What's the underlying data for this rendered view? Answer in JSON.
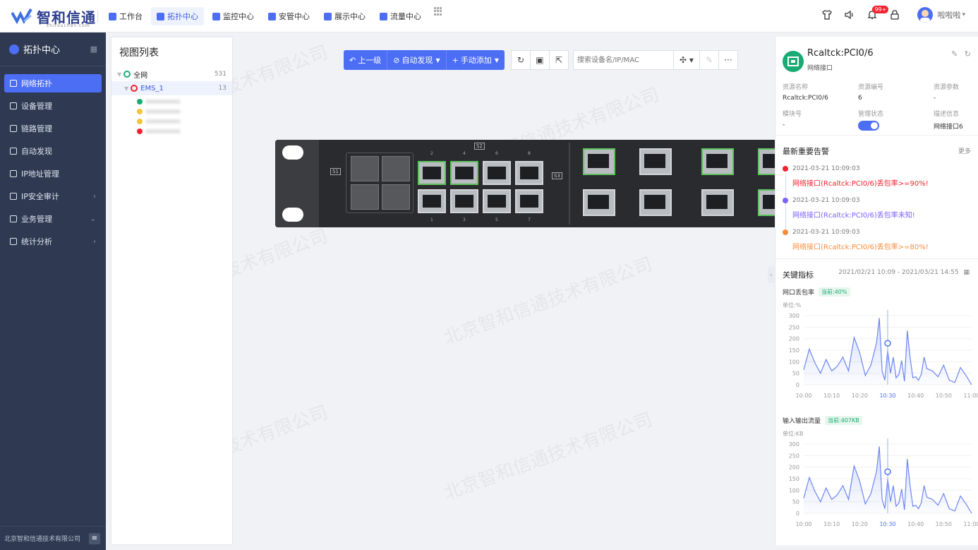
{
  "header": {
    "logo_text": "智和信通",
    "logo_sub": "zhitouchan.com",
    "nav": [
      {
        "label": "工作台",
        "icon": "home-icon",
        "color": "#4c6ef5",
        "active": false
      },
      {
        "label": "拓扑中心",
        "icon": "topology-icon",
        "color": "#4c6ef5",
        "active": true
      },
      {
        "label": "监控中心",
        "icon": "monitor-icon",
        "color": "#4c6ef5",
        "active": false
      },
      {
        "label": "安管中心",
        "icon": "shield-icon",
        "color": "#4c6ef5",
        "active": false
      },
      {
        "label": "展示中心",
        "icon": "display-icon",
        "color": "#4c6ef5",
        "active": false
      },
      {
        "label": "流量中心",
        "icon": "traffic-icon",
        "color": "#4c6ef5",
        "active": false
      }
    ],
    "notify_badge": "99+",
    "user_name": "啦啦啦"
  },
  "sidebar": {
    "title": "拓扑中心",
    "items": [
      {
        "label": "网络拓扑",
        "active": true,
        "arrow": ""
      },
      {
        "label": "设备管理",
        "active": false,
        "arrow": ""
      },
      {
        "label": "链路管理",
        "active": false,
        "arrow": ""
      },
      {
        "label": "自动发现",
        "active": false,
        "arrow": ""
      },
      {
        "label": "IP地址管理",
        "active": false,
        "arrow": ""
      },
      {
        "label": "IP安全审计",
        "active": false,
        "arrow": ">"
      },
      {
        "label": "业务管理",
        "active": false,
        "arrow": "v"
      },
      {
        "label": "统计分析",
        "active": false,
        "arrow": ">"
      }
    ],
    "footer": "北京智和信通技术有限公司"
  },
  "view_panel": {
    "title": "视图列表",
    "tree": [
      {
        "label": "全网",
        "count": "531",
        "color": "#1aaa73",
        "selected": false
      },
      {
        "label": "EMS_1",
        "count": "13",
        "color": "#f5222d",
        "selected": true
      }
    ]
  },
  "toolbar": {
    "up_level": "上一级",
    "auto_discover": "自动发现",
    "manual_add": "手动添加",
    "search_placeholder": "搜索设备名/IP/MAC"
  },
  "watermark": "北京智和信通技术有限公司",
  "device": {
    "slot_labels": [
      "S1",
      "S2",
      "S3"
    ],
    "top_port_numbers": [
      "2",
      "4",
      "6",
      "8"
    ],
    "bottom_port_numbers": [
      "1",
      "3",
      "5",
      "7"
    ]
  },
  "detail": {
    "name": "Rcaltck:PCI0/6",
    "type": "网络接口",
    "fields": [
      {
        "key": "资源名称",
        "value": "Rcaltck:PCI0/6"
      },
      {
        "key": "资源编号",
        "value": "6"
      },
      {
        "key": "资源参数",
        "value": "-"
      },
      {
        "key": "模块号",
        "value": "-"
      },
      {
        "key": "管理状态",
        "value": ""
      },
      {
        "key": "描述信息",
        "value": "网络接口6"
      }
    ]
  },
  "alarms": {
    "title": "最新重要告警",
    "more": "更多",
    "items": [
      {
        "time": "2021-03-21 10:09:03",
        "message": "网络接口(Rcaltck:PCI0/6)丢包率>=90%!",
        "color": "#f5222d"
      },
      {
        "time": "2021-03-21 10:09:03",
        "message": "网络接口(Rcaltck:PCI0/6)丢包率未知!",
        "color": "#7b61ff"
      },
      {
        "time": "2021-03-21 10:09:03",
        "message": "网络接口(Rcaltck:PCI0/6)丢包率>=80%!",
        "color": "#fa8c3c"
      }
    ]
  },
  "kpi": {
    "title": "关键指标",
    "range": "2021/02/21 10:09 - 2021/03/21 14:55"
  },
  "chart_data": [
    {
      "type": "area",
      "title": "网口丢包率",
      "current": "当前:40%",
      "unit": "单位:%",
      "ylim": [
        0,
        300
      ],
      "yticks": [
        0,
        50,
        100,
        150,
        200,
        250,
        300
      ],
      "xticks": [
        "10:00",
        "10:10",
        "10:20",
        "10:30",
        "10:40",
        "10:50",
        "11:00"
      ],
      "highlight": "10:30",
      "x": [
        0,
        2,
        4,
        6,
        8,
        10,
        12,
        14,
        16,
        18,
        20,
        22,
        24,
        26,
        27,
        28,
        29,
        30,
        31,
        32,
        33,
        34,
        35,
        36,
        37,
        38,
        39,
        40,
        41,
        42,
        43,
        44,
        46,
        48,
        50,
        52,
        54,
        56,
        58,
        60
      ],
      "values": [
        65,
        155,
        95,
        50,
        110,
        60,
        80,
        120,
        60,
        205,
        140,
        40,
        85,
        180,
        290,
        60,
        20,
        150,
        50,
        120,
        30,
        45,
        105,
        15,
        235,
        120,
        30,
        35,
        20,
        45,
        120,
        70,
        60,
        35,
        85,
        20,
        10,
        75,
        40,
        0
      ],
      "marker_x": 30,
      "marker_y": 180
    },
    {
      "type": "area",
      "title": "输入输出流量",
      "current": "当前:407KB",
      "unit": "单位:KB",
      "ylim": [
        0,
        300
      ],
      "yticks": [
        0,
        50,
        100,
        150,
        200,
        250,
        300
      ],
      "xticks": [
        "10:00",
        "10:10",
        "10:20",
        "10:30",
        "10:40",
        "10:50",
        "11:00"
      ],
      "highlight": "10:30",
      "x": [
        0,
        2,
        4,
        6,
        8,
        10,
        12,
        14,
        16,
        18,
        20,
        22,
        24,
        26,
        27,
        28,
        29,
        30,
        31,
        32,
        33,
        34,
        35,
        36,
        37,
        38,
        39,
        40,
        41,
        42,
        43,
        44,
        46,
        48,
        50,
        52,
        54,
        56,
        58,
        60
      ],
      "values": [
        65,
        155,
        95,
        50,
        110,
        60,
        80,
        120,
        60,
        205,
        140,
        40,
        85,
        180,
        290,
        60,
        20,
        150,
        50,
        120,
        30,
        45,
        105,
        15,
        235,
        120,
        30,
        35,
        20,
        45,
        120,
        70,
        60,
        35,
        85,
        20,
        10,
        75,
        40,
        0
      ],
      "marker_x": 30,
      "marker_y": 180
    }
  ]
}
